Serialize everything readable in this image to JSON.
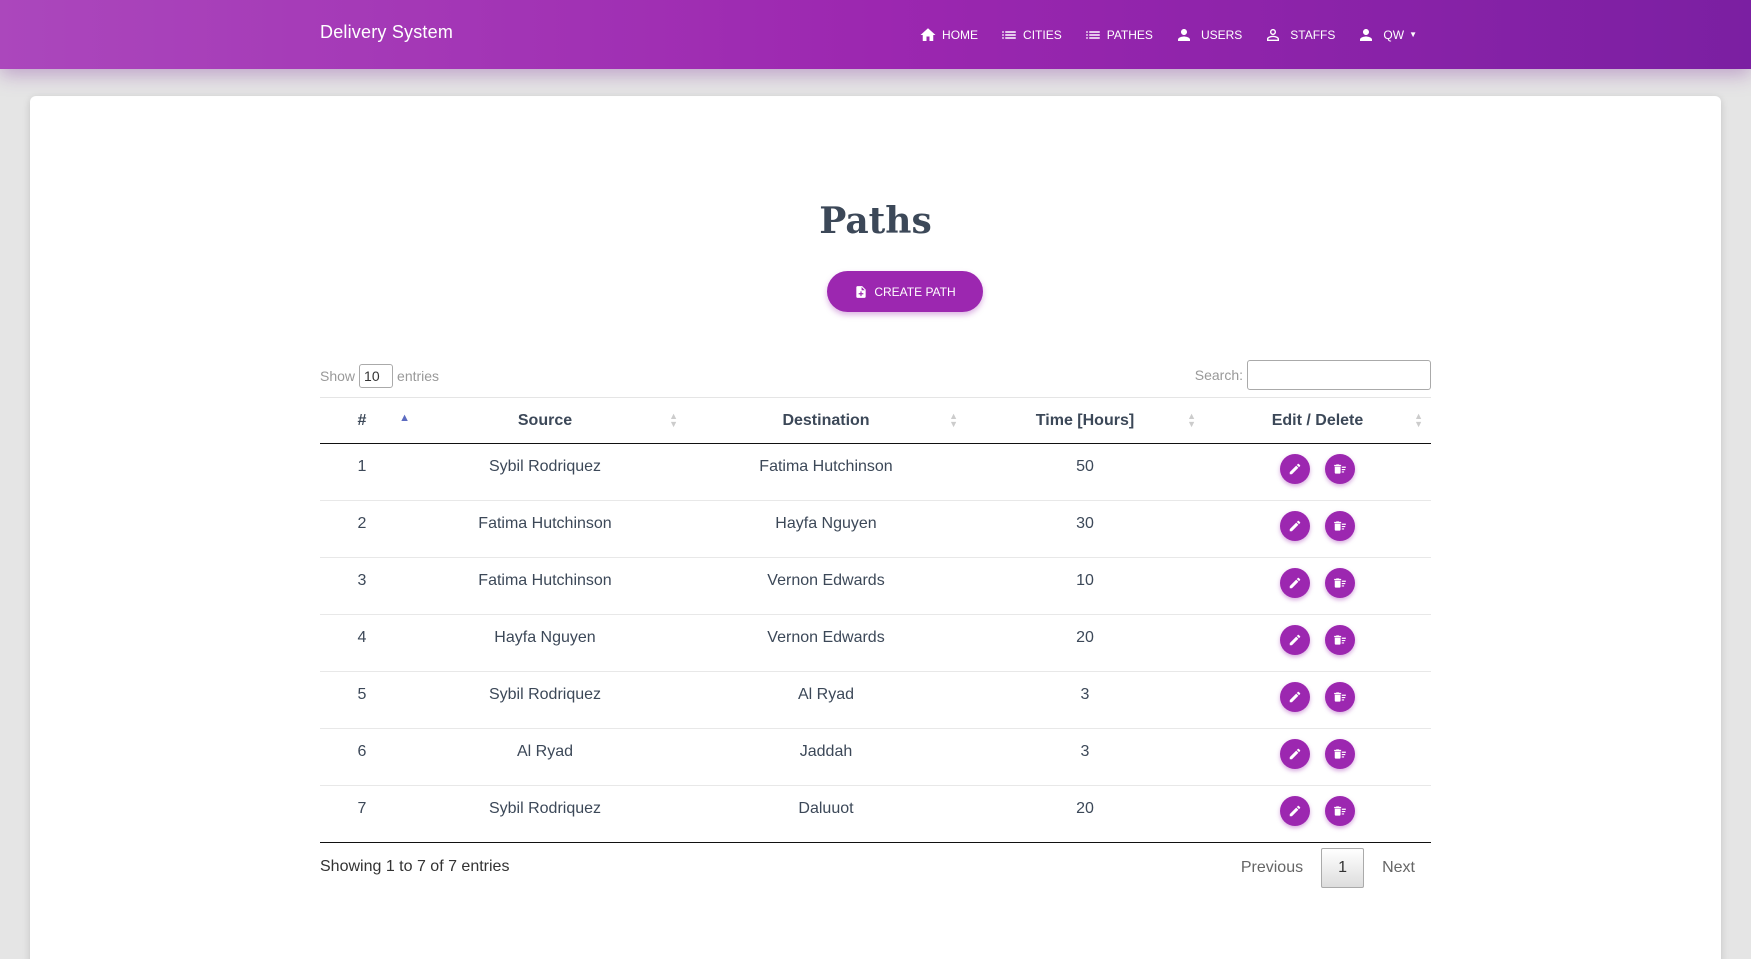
{
  "nav": {
    "brand": "Delivery System",
    "items": [
      {
        "label": "HOME",
        "icon": "home-icon"
      },
      {
        "label": "CITIES",
        "icon": "list-icon"
      },
      {
        "label": "PATHES",
        "icon": "list-icon"
      },
      {
        "label": "USERS",
        "icon": "person-icon"
      },
      {
        "label": "STAFFS",
        "icon": "person-outline-icon"
      },
      {
        "label": "QW",
        "icon": "person-icon"
      }
    ]
  },
  "page": {
    "title": "Paths",
    "create_label": "CREATE PATH"
  },
  "controls": {
    "show_label": "Show",
    "entries_value": "10",
    "entries_label": "entries",
    "search_label": "Search:",
    "search_value": ""
  },
  "table": {
    "columns": [
      "#",
      "Source",
      "Destination",
      "Time [Hours]",
      "Edit / Delete"
    ],
    "rows": [
      [
        "1",
        "Sybil Rodriquez",
        "Fatima Hutchinson",
        "50"
      ],
      [
        "2",
        "Fatima Hutchinson",
        "Hayfa Nguyen",
        "30"
      ],
      [
        "3",
        "Fatima Hutchinson",
        "Vernon Edwards",
        "10"
      ],
      [
        "4",
        "Hayfa Nguyen",
        "Vernon Edwards",
        "20"
      ],
      [
        "5",
        "Sybil Rodriquez",
        "Al Ryad",
        "3"
      ],
      [
        "6",
        "Al Ryad",
        "Jaddah",
        "3"
      ],
      [
        "7",
        "Sybil Rodriquez",
        "Daluuot",
        "20"
      ]
    ]
  },
  "footer": {
    "info": "Showing 1 to 7 of 7 entries",
    "previous": "Previous",
    "current_page": "1",
    "next": "Next"
  },
  "colors": {
    "primary": "#9c27b0",
    "nav_gradient_start": "#ab47bc",
    "nav_gradient_end": "#7b1fa2"
  }
}
